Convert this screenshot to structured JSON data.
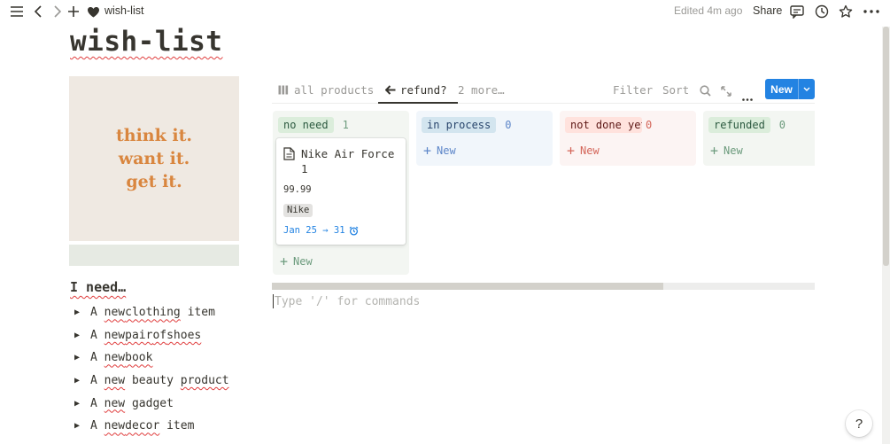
{
  "topbar": {
    "page_name": "wish-list",
    "edited": "Edited 4m ago",
    "share": "Share"
  },
  "page": {
    "title": "wish-list"
  },
  "cover": {
    "line1": "think it.",
    "line2": "want it.",
    "line3": "get it."
  },
  "needs": {
    "title": "I need…",
    "items": [
      "A new clothing item",
      "A new pair of shoes",
      "A new book",
      "A new beauty product",
      "A new gadget",
      "A new decor item"
    ]
  },
  "board": {
    "tabs": {
      "all_products": "all products",
      "refund": "refund?",
      "more": "2 more…"
    },
    "filter": "Filter",
    "sort": "Sort",
    "new_button": "New",
    "add_label": "New",
    "columns": [
      {
        "name": "no need",
        "count": "1",
        "bg": "#f3f6f2",
        "tag_bg": "#dbeddb",
        "tag_color": "#2b593f",
        "count_color": "#6c9b7d"
      },
      {
        "name": "in process",
        "count": "0",
        "bg": "#f1f6fb",
        "tag_bg": "#d3e5ef",
        "tag_color": "#28456c",
        "count_color": "#5e87c9"
      },
      {
        "name": "not done yet",
        "count": "0",
        "bg": "#fcf4f3",
        "tag_bg": "#ffe2dd",
        "tag_color": "#5d1715",
        "count_color": "#d4665a"
      },
      {
        "name": "refunded",
        "count": "0",
        "bg": "#f3f6f2",
        "tag_bg": "#dbeddb",
        "tag_color": "#2b593f",
        "count_color": "#6c9b7d"
      }
    ],
    "card": {
      "title": "Nike Air Force 1",
      "price": "99.99",
      "brand": "Nike",
      "date": "Jan 25 → 31"
    }
  },
  "editor": {
    "placeholder": "Type '/' for commands"
  },
  "help": {
    "label": "?"
  }
}
